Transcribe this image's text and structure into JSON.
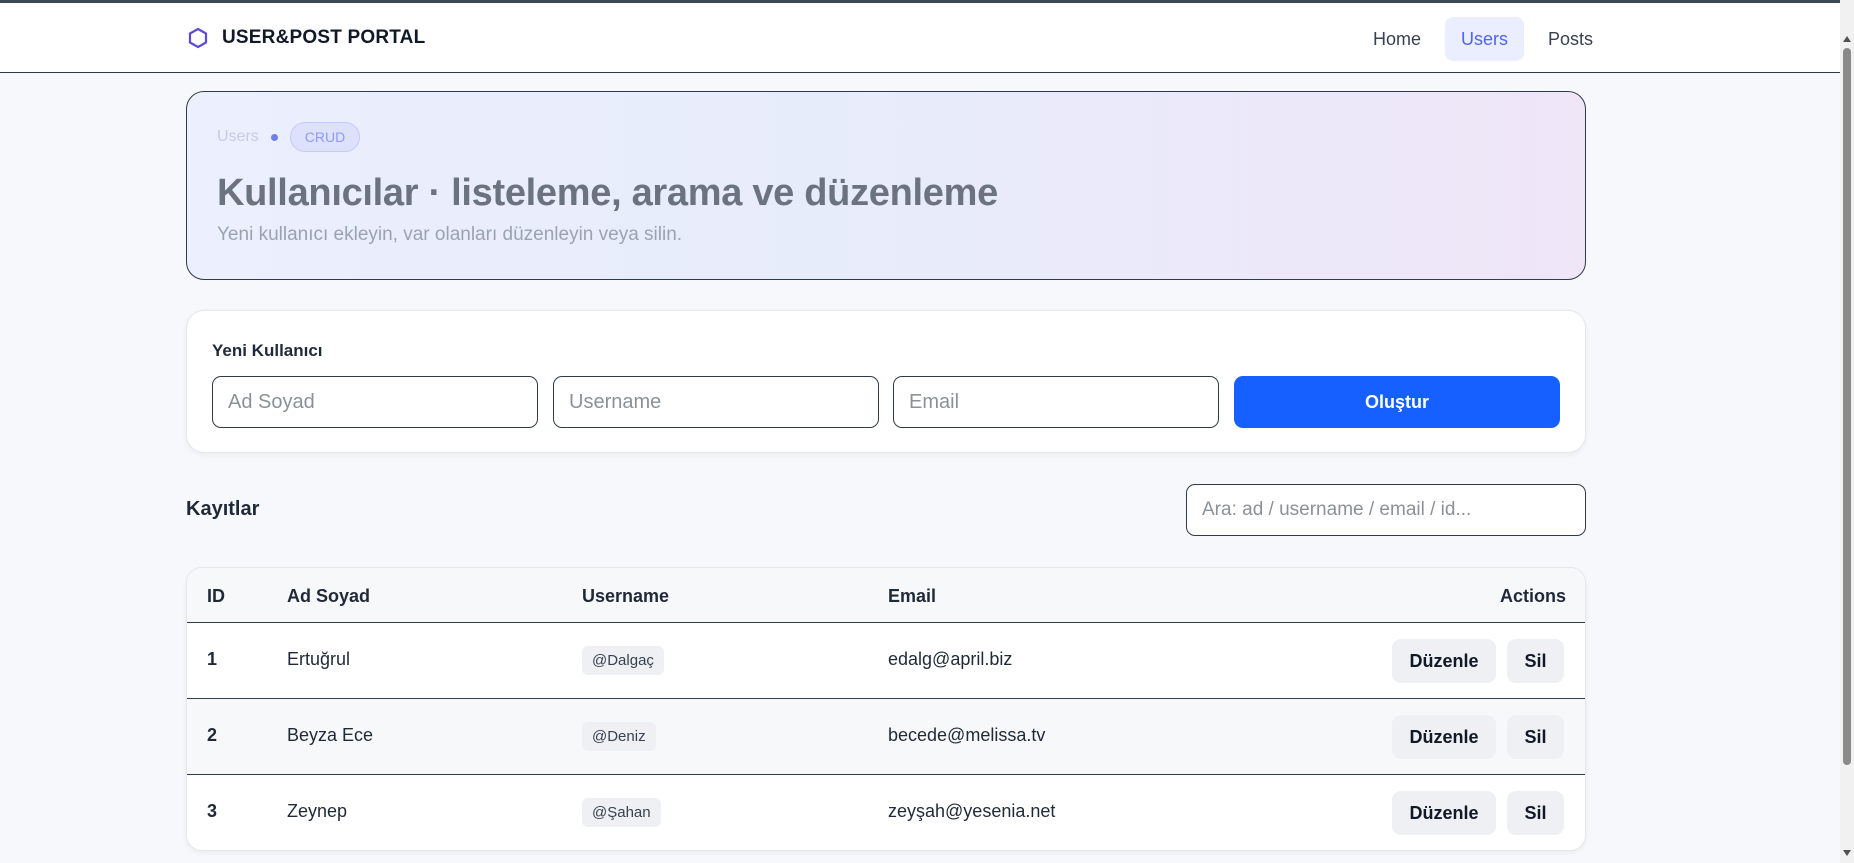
{
  "navbar": {
    "brand": "USER&POST PORTAL",
    "brand_icon": "hexagon-icon",
    "links": [
      {
        "label": "Home",
        "active": false
      },
      {
        "label": "Users",
        "active": true
      },
      {
        "label": "Posts",
        "active": false
      }
    ]
  },
  "hero": {
    "breadcrumb": "Users",
    "badge": "CRUD",
    "title": "Kullanıcılar · listeleme, arama ve düzenleme",
    "subtitle": "Yeni kullanıcı ekleyin, var olanları düzenleyin veya silin."
  },
  "new_user": {
    "title": "Yeni Kullanıcı",
    "name_placeholder": "Ad Soyad",
    "username_placeholder": "Username",
    "email_placeholder": "Email",
    "submit_label": "Oluştur"
  },
  "records": {
    "title": "Kayıtlar",
    "search_placeholder": "Ara: ad / username / email / id..."
  },
  "table": {
    "headers": {
      "id": "ID",
      "name": "Ad Soyad",
      "username": "Username",
      "email": "Email",
      "actions": "Actions"
    },
    "edit_label": "Düzenle",
    "delete_label": "Sil",
    "rows": [
      {
        "id": "1",
        "name": "Ertuğrul",
        "username": "@Dalgaç",
        "email": "edalg@april.biz"
      },
      {
        "id": "2",
        "name": "Beyza Ece",
        "username": "@Deniz",
        "email": "becede@melissa.tv"
      },
      {
        "id": "3",
        "name": "Zeynep",
        "username": "@Şahan",
        "email": "zeyşah@yesenia.net"
      }
    ]
  },
  "colors": {
    "accent": "#1560ff",
    "nav_active_bg": "#ebeefe",
    "nav_active_text": "#4f63f5",
    "brand_icon": "#5b4bd8"
  }
}
